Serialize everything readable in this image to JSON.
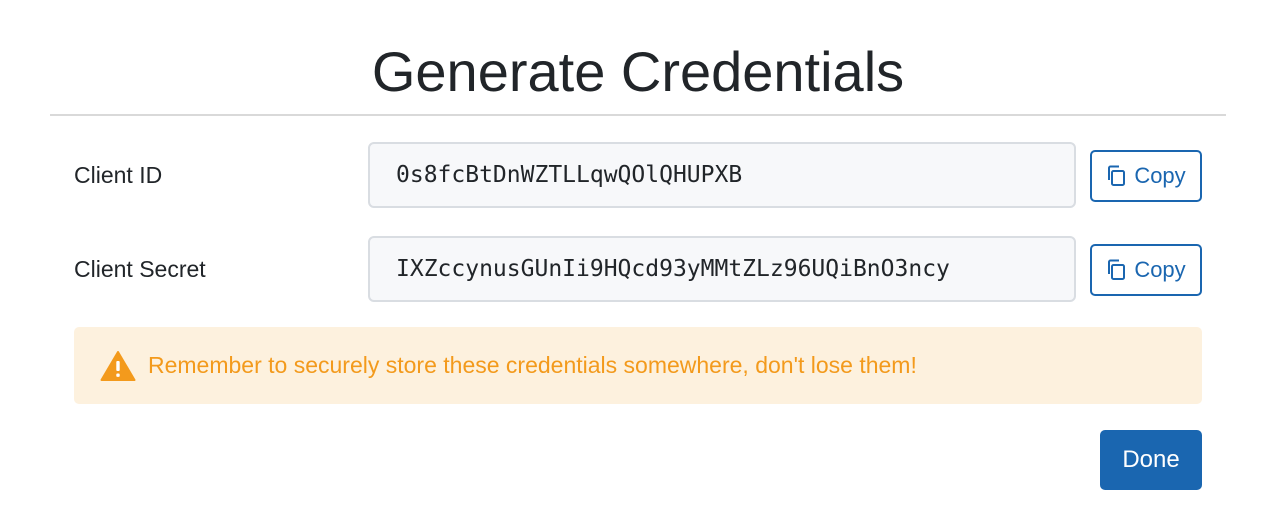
{
  "dialog": {
    "title": "Generate Credentials"
  },
  "fields": [
    {
      "label": "Client ID",
      "value": "0s8fcBtDnWZTLLqwQOlQHUPXB",
      "copy_label": "Copy",
      "copy_icon": "copy-icon"
    },
    {
      "label": "Client Secret",
      "value": "IXZccynusGUnIi9HQcd93yMMtZLz96UQiBnO3ncy",
      "copy_label": "Copy",
      "copy_icon": "copy-icon"
    }
  ],
  "alert": {
    "icon": "warning-triangle-icon",
    "text": "Remember to securely store these credentials somewhere, don't lose them!",
    "text_color": "#f39a1c",
    "background": "#fdf1de"
  },
  "footer": {
    "done_label": "Done"
  },
  "colors": {
    "accent": "#1a66b0",
    "divider": "#d9d9d9",
    "field_background": "#f7f8fa"
  }
}
